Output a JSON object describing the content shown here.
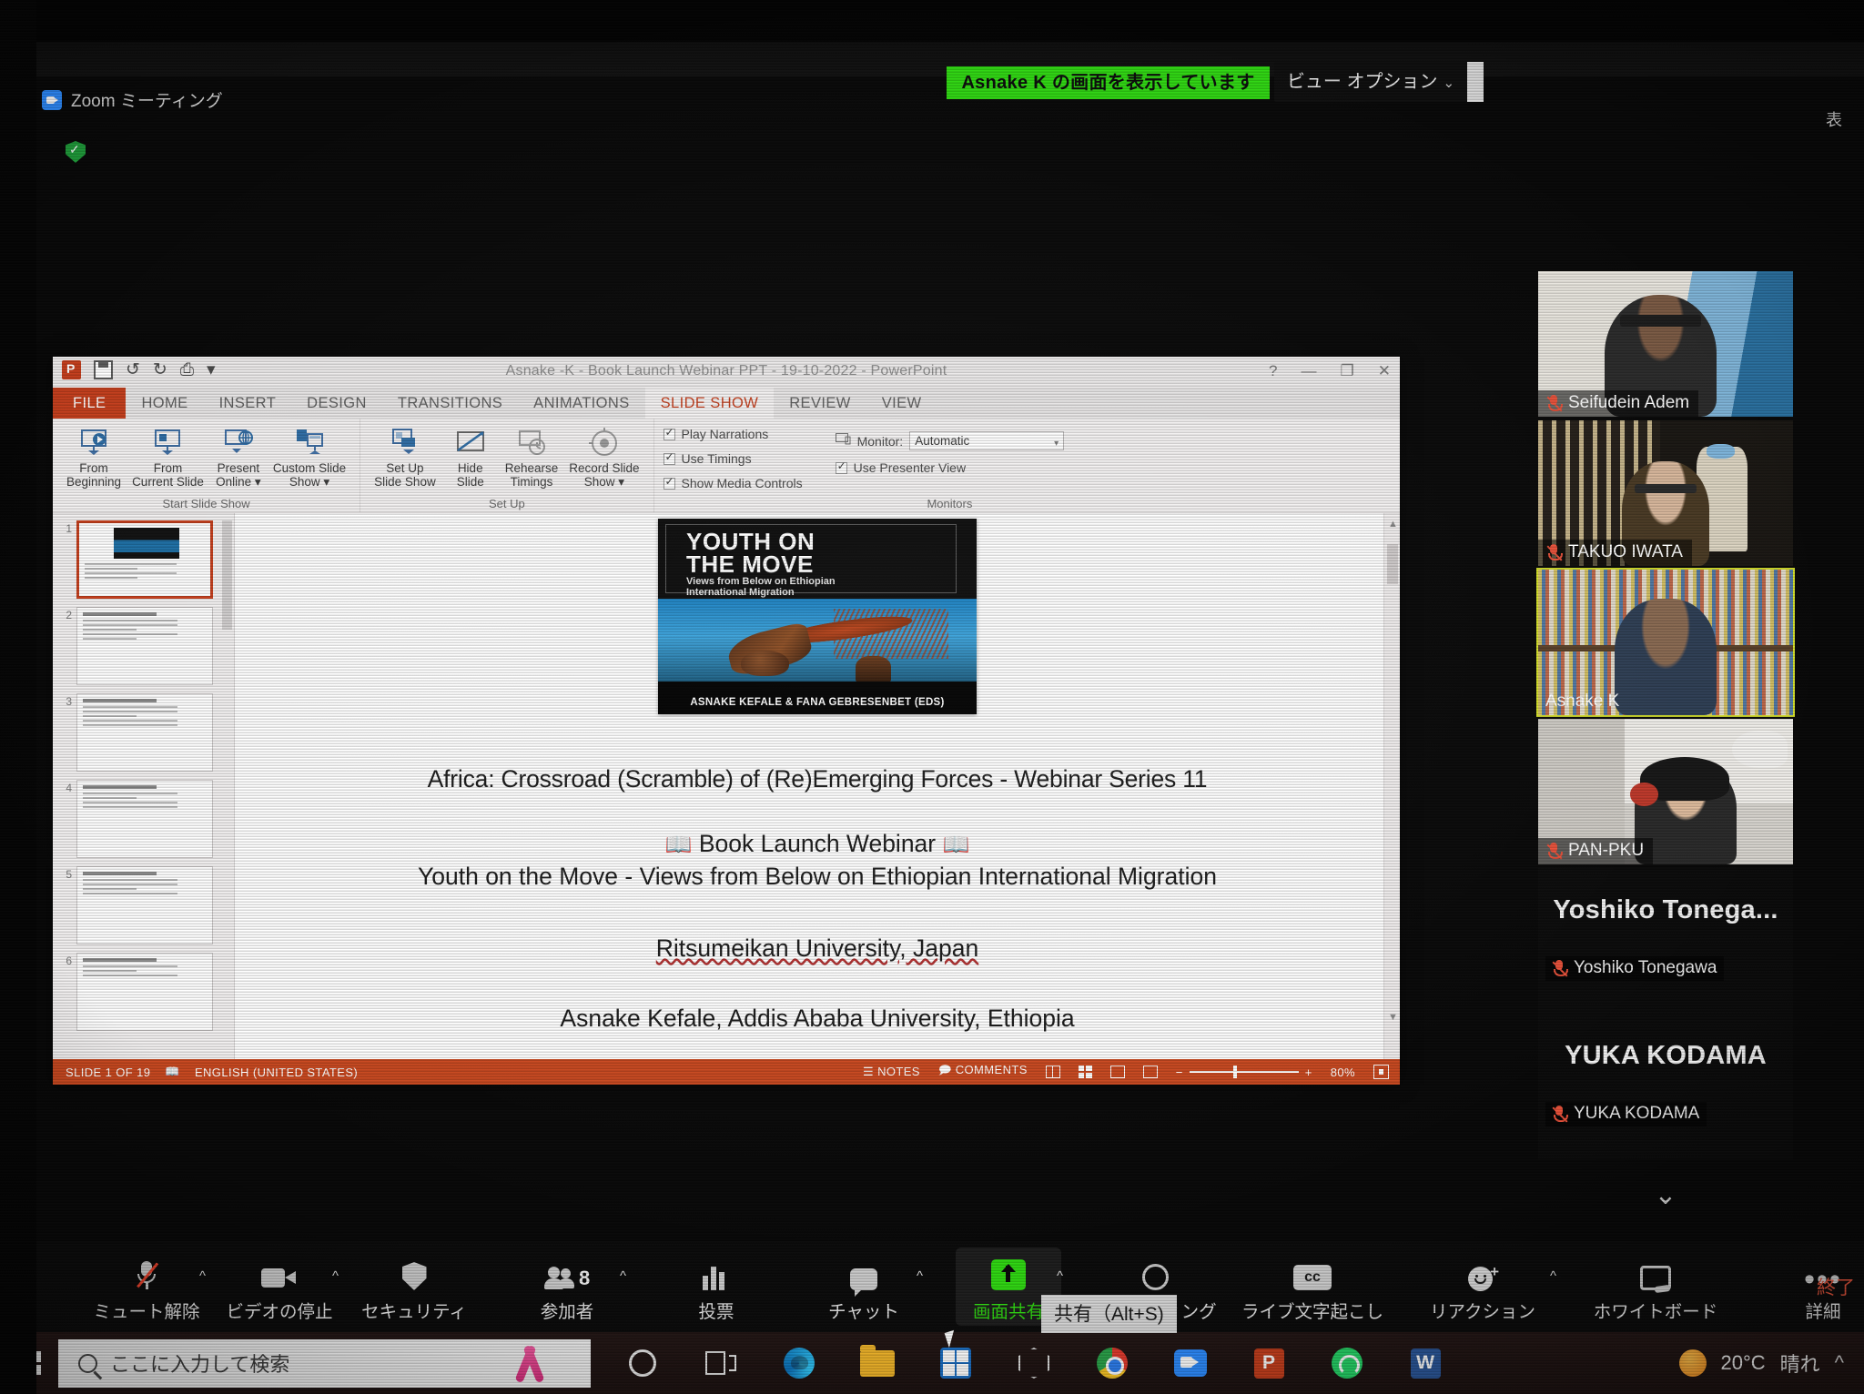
{
  "zoom_share": {
    "banner_text": "Asnake K の画面を表示しています",
    "view_options_label": "ビュー オプション",
    "chevron": "⌄",
    "window_title": "Zoom ミーティング",
    "top_right_label": "表"
  },
  "powerpoint": {
    "title": "Asnake -K - Book Launch Webinar PPT - 19-10-2022 - PowerPoint",
    "quick_access": [
      "save-icon",
      "undo-icon",
      "redo-icon",
      "start-from-beginning-icon",
      "customize-icon"
    ],
    "window_buttons": [
      "?",
      "—",
      "□",
      "✕"
    ],
    "tabs": [
      {
        "label": "FILE",
        "active": false,
        "kind": "file"
      },
      {
        "label": "HOME",
        "active": false
      },
      {
        "label": "INSERT",
        "active": false
      },
      {
        "label": "DESIGN",
        "active": false
      },
      {
        "label": "TRANSITIONS",
        "active": false
      },
      {
        "label": "ANIMATIONS",
        "active": false
      },
      {
        "label": "SLIDE SHOW",
        "active": true
      },
      {
        "label": "REVIEW",
        "active": false
      },
      {
        "label": "VIEW",
        "active": false
      }
    ],
    "ribbon": {
      "groups": [
        {
          "name": "Start Slide Show",
          "buttons": [
            {
              "label": "From\nBeginning",
              "icon": "from-beginning-icon"
            },
            {
              "label": "From\nCurrent Slide",
              "icon": "from-current-slide-icon"
            },
            {
              "label": "Present\nOnline ▾",
              "icon": "present-online-icon"
            },
            {
              "label": "Custom Slide\nShow ▾",
              "icon": "custom-slide-show-icon"
            }
          ]
        },
        {
          "name": "Set Up",
          "buttons": [
            {
              "label": "Set Up\nSlide Show",
              "icon": "set-up-slide-show-icon"
            },
            {
              "label": "Hide\nSlide",
              "icon": "hide-slide-icon"
            },
            {
              "label": "Rehearse\nTimings",
              "icon": "rehearse-timings-icon"
            },
            {
              "label": "Record Slide\nShow ▾",
              "icon": "record-slide-show-icon"
            }
          ]
        }
      ],
      "checkboxes": [
        {
          "label": "Play Narrations",
          "checked": true
        },
        {
          "label": "Use Timings",
          "checked": true
        },
        {
          "label": "Show Media Controls",
          "checked": true
        }
      ],
      "monitors": {
        "group_name": "Monitors",
        "monitor_label": "Monitor:",
        "monitor_value": "Automatic",
        "presenter_view_label": "Use Presenter View",
        "presenter_view_checked": true
      }
    },
    "thumbnails": [
      {
        "number": "1",
        "selected": true
      },
      {
        "number": "2",
        "selected": false
      },
      {
        "number": "3",
        "selected": false
      },
      {
        "number": "4",
        "selected": false
      },
      {
        "number": "5",
        "selected": false
      },
      {
        "number": "6",
        "selected": false
      }
    ],
    "slide": {
      "cover": {
        "title_line1": "YOUTH ON",
        "title_line2": "THE MOVE",
        "subtitle_line1": "Views from Below on Ethiopian",
        "subtitle_line2": "International Migration",
        "authors": "ASNAKE KEFALE & FANA GEBRESENBET (EDS)"
      },
      "line1": "Africa: Crossroad (Scramble) of (Re)Emerging Forces - Webinar Series 11",
      "line2_icon_left": "📖",
      "line2": "Book Launch Webinar",
      "line2_icon_right": "📖",
      "line3": "Youth on the Move - Views from Below on Ethiopian International Migration",
      "line4": "Ritsumeikan University, Japan",
      "line5": "Asnake Kefale, Addis Ababa University, Ethiopia"
    },
    "status_bar": {
      "slide_counter": "SLIDE 1 OF 19",
      "language": "ENGLISH (UNITED STATES)",
      "notes_label": "NOTES",
      "comments_label": "COMMENTS",
      "zoom_level": "80%",
      "zoom_out": "−",
      "zoom_in": "+"
    }
  },
  "participants": {
    "tiles": [
      {
        "name": "Seifudein Adem",
        "muted": true,
        "active": false,
        "style": "ph1"
      },
      {
        "name": "TAKUO  IWATA",
        "muted": true,
        "active": false,
        "style": "ph2"
      },
      {
        "name": "Asnake K",
        "muted": false,
        "active": true,
        "style": "ph3"
      },
      {
        "name": "PAN-PKU",
        "muted": true,
        "active": false,
        "style": "ph4"
      }
    ],
    "name_tiles": [
      {
        "big": "Yoshiko  Tonega...",
        "small": "Yoshiko Tonegawa",
        "muted": true
      },
      {
        "big": "YUKA KODAMA",
        "small": "YUKA KODAMA",
        "muted": true
      }
    ],
    "more_chevron": "⌄"
  },
  "zoom_toolbar": {
    "buttons": [
      {
        "label": "ミュート解除",
        "icon": "microphone-muted-icon",
        "caret": true
      },
      {
        "label": "ビデオの停止",
        "icon": "video-camera-icon",
        "caret": true
      },
      {
        "label": "セキュリティ",
        "icon": "shield-icon",
        "caret": false
      },
      {
        "label": "参加者",
        "icon": "participants-icon",
        "caret": true,
        "badge": "8"
      },
      {
        "label": "投票",
        "icon": "poll-icon",
        "caret": false
      },
      {
        "label": "チャット",
        "icon": "chat-icon",
        "caret": true
      },
      {
        "label": "画面共有",
        "icon": "share-screen-icon",
        "caret": true,
        "highlight": true
      },
      {
        "label": "レコーディング",
        "icon": "record-icon",
        "caret": false
      },
      {
        "label": "ライブ文字起こし",
        "icon": "closed-caption-icon",
        "caret": false
      },
      {
        "label": "リアクション",
        "icon": "reactions-icon",
        "caret": true
      },
      {
        "label": "ホワイトボード",
        "icon": "whiteboard-icon",
        "caret": false
      },
      {
        "label": "詳細",
        "icon": "more-icon",
        "caret": false
      }
    ],
    "tooltip": "共有（Alt+S)",
    "end_label": "終了"
  },
  "taskbar": {
    "search_placeholder": "ここに入力して検索",
    "weather_temp": "20°C",
    "weather_desc": "晴れ",
    "tray_chevron": "^",
    "apps": [
      "cortana-icon",
      "task-view-icon",
      "edge-icon",
      "file-explorer-icon",
      "microsoft-store-icon",
      "3d-viewer-icon",
      "chrome-icon",
      "zoom-app-icon",
      "powerpoint-app-icon",
      "whatsapp-icon",
      "word-app-icon"
    ]
  }
}
